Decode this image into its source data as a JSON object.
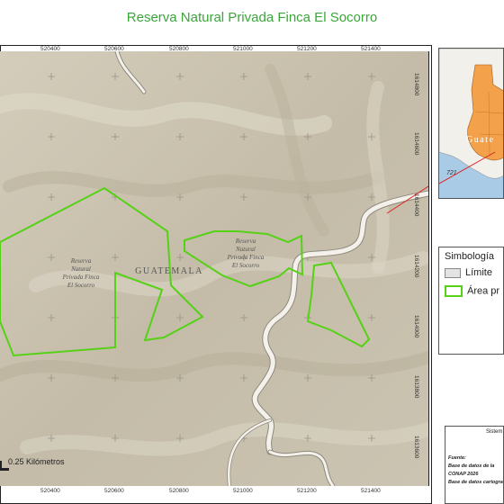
{
  "title": "Reserva Natural Privada Finca El Socorro",
  "axes": {
    "top_ticks": [
      "520400",
      "520600",
      "520800",
      "521000",
      "521200",
      "521400"
    ],
    "bottom_ticks": [
      "520400",
      "520600",
      "520800",
      "521000",
      "521200",
      "521400"
    ],
    "right_ticks": [
      "1614800",
      "1614600",
      "1614400",
      "1614200",
      "1614000",
      "1613800",
      "1613600"
    ]
  },
  "map": {
    "labels": {
      "reserve_left": [
        "Reserva",
        "Natural",
        "Privada Finca",
        "El Socorro"
      ],
      "reserve_center": [
        "Reserva",
        "Natural",
        "Privada Finca",
        "El Socorro"
      ],
      "country": "GUATEMALA"
    },
    "colors": {
      "terrain": "#c9c2b0",
      "reserve_outline": "#55d116",
      "road": "#f4f1ea"
    }
  },
  "inset": {
    "country_label": "Guate",
    "number_label": "721",
    "colors": {
      "sea": "#a9cbe6",
      "land": "#f2f0ea",
      "guatemala": "#f3a24b"
    }
  },
  "legend": {
    "title": "Simbología",
    "items": [
      {
        "label": "Límite",
        "style": "limit"
      },
      {
        "label": "Área pr",
        "style": "area"
      }
    ]
  },
  "info": {
    "system_label": "Sistem",
    "source_title": "Fuente:",
    "lines": [
      "Base de datos de la",
      "CONAP 2026",
      "Base de datos cartogra"
    ]
  },
  "scale": {
    "label": "0.25 Kilómetros"
  }
}
